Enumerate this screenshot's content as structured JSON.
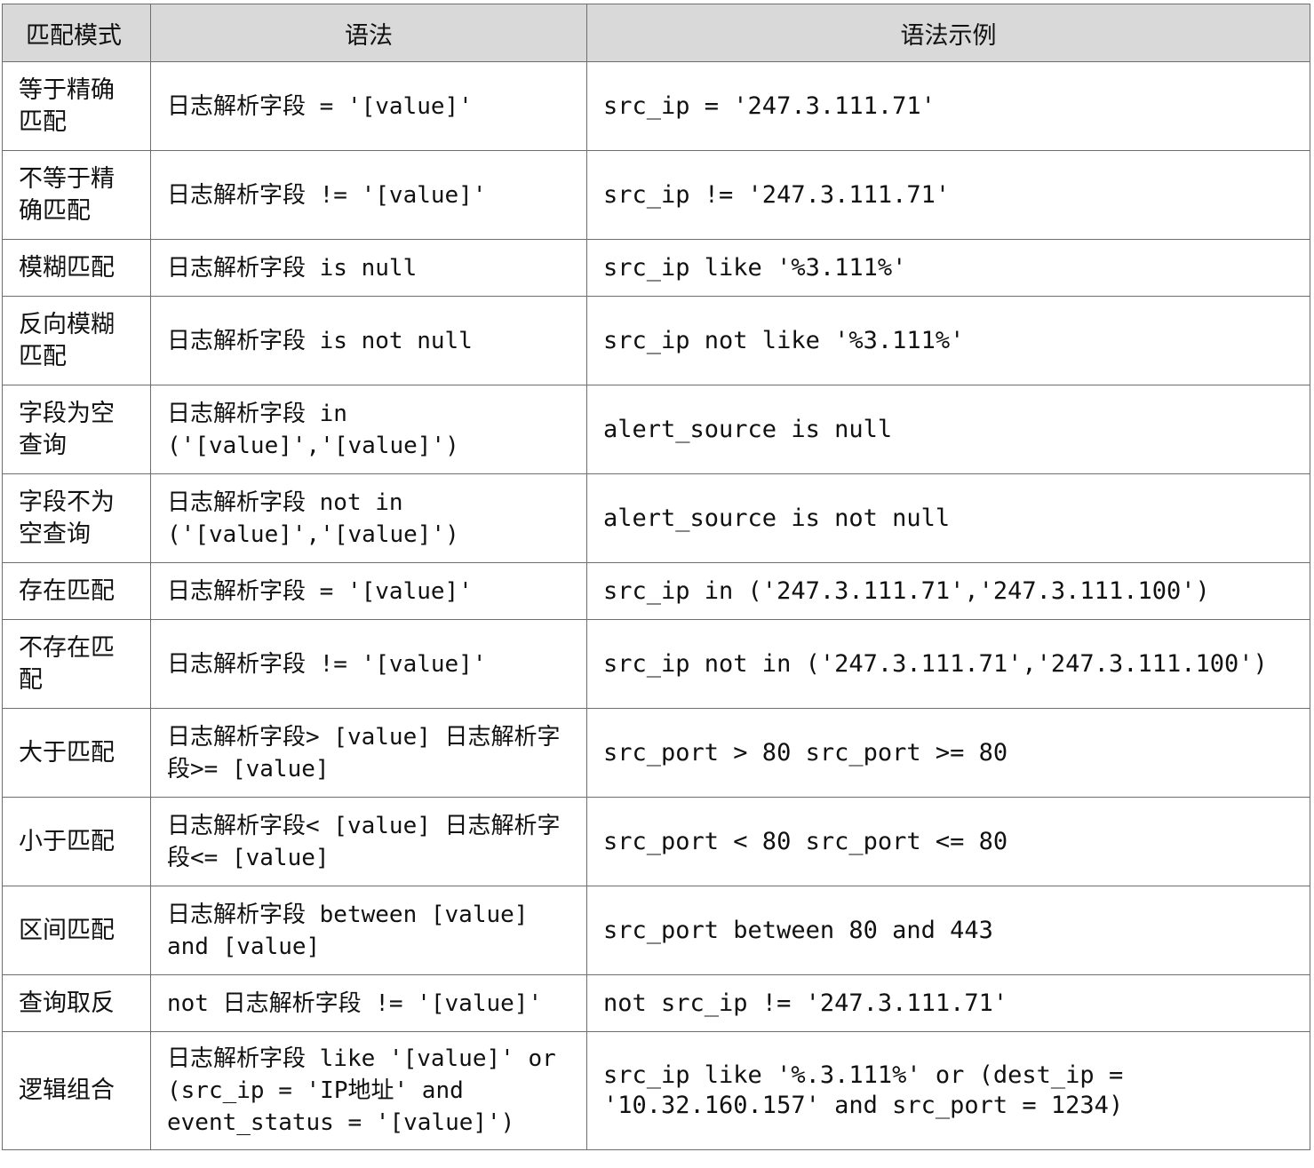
{
  "header": {
    "mode": "匹配模式",
    "syntax": "语法",
    "example": "语法示例"
  },
  "rows": [
    {
      "mode": "等于精确匹配",
      "syntax": "日志解析字段 = '[value]'",
      "example": "src_ip = '247.3.111.71'"
    },
    {
      "mode": "不等于精确匹配",
      "syntax": "日志解析字段 != '[value]'",
      "example": "src_ip != '247.3.111.71'"
    },
    {
      "mode": "模糊匹配",
      "syntax": "日志解析字段 is null",
      "example": "src_ip like '%3.111%'"
    },
    {
      "mode": "反向模糊匹配",
      "syntax": "日志解析字段 is not null",
      "example": "src_ip not like '%3.111%'"
    },
    {
      "mode": "字段为空查询",
      "syntax": "日志解析字段 in ('[value]','[value]')",
      "example": "alert_source is null"
    },
    {
      "mode": "字段不为空查询",
      "syntax": "日志解析字段 not in ('[value]','[value]')",
      "example": "alert_source is not null"
    },
    {
      "mode": "存在匹配",
      "syntax": "日志解析字段 = '[value]'",
      "example": "src_ip in ('247.3.111.71','247.3.111.100')"
    },
    {
      "mode": "不存在匹配",
      "syntax": "日志解析字段 != '[value]'",
      "example": "src_ip not in ('247.3.111.71','247.3.111.100')"
    },
    {
      "mode": "大于匹配",
      "syntax": "日志解析字段> [value] 日志解析字段>= [value]",
      "example": "src_port > 80 src_port >= 80"
    },
    {
      "mode": "小于匹配",
      "syntax": "日志解析字段< [value] 日志解析字段<= [value]",
      "example": "src_port < 80 src_port <= 80"
    },
    {
      "mode": "区间匹配",
      "syntax": "日志解析字段 between [value] and [value]",
      "example": "src_port between 80 and 443"
    },
    {
      "mode": "查询取反",
      "syntax": "not 日志解析字段 != '[value]'",
      "example": "not src_ip != '247.3.111.71'"
    },
    {
      "mode": "逻辑组合",
      "syntax": "日志解析字段 like '[value]' or (src_ip = 'IP地址' and event_status = '[value]')",
      "example": "src_ip like '%.3.111%' or (dest_ip = '10.32.160.157' and src_port = 1234)"
    }
  ]
}
